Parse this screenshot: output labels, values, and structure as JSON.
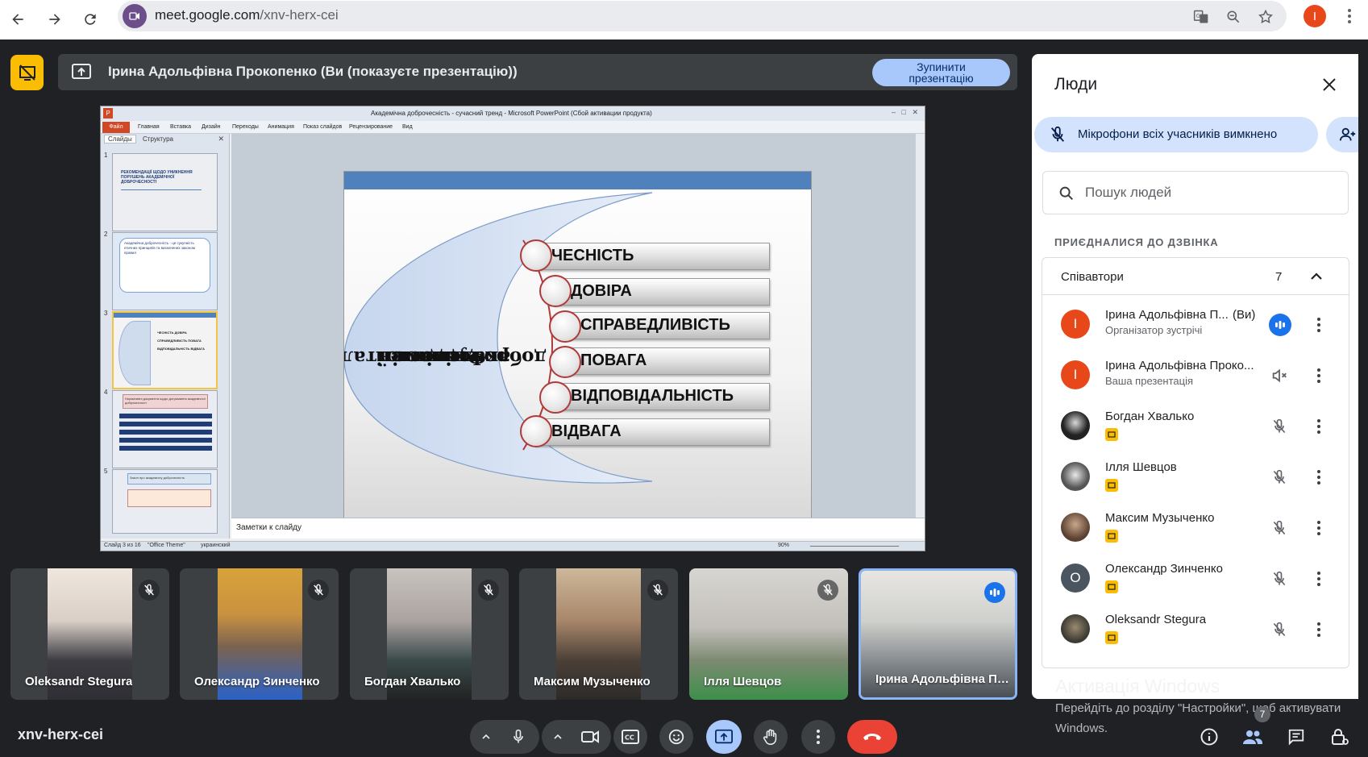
{
  "browser": {
    "url_host": "meet.google.com",
    "url_path": "/xnv-herx-cei",
    "profile_initial": "I"
  },
  "presentation_bar": {
    "title": "Ірина Адольфівна Прокопенко (Ви (показуєте презентацію))",
    "stop_label_line1": "Зупинити",
    "stop_label_line2": "презентацію"
  },
  "powerpoint": {
    "window_title": "Академічна доброчесність - сучасний тренд - Microsoft PowerPoint (Сбой активации продукта)",
    "file_tab": "Файл",
    "tabs": [
      "Главная",
      "Вставка",
      "Дизайн",
      "Переходы",
      "Анимация",
      "Показ слайдов",
      "Рецензирование",
      "Вид"
    ],
    "panel_tabs": [
      "Слайды",
      "Структура"
    ],
    "thumbnails": [
      {
        "num": "1",
        "text": "РЕКОМЕНДАЦІЇ ЩОДО УНИКНЕННЯ ПОРУШЕНЬ АКАДЕМІЧНОЇ ДОБРОЧЕСНОСТІ"
      },
      {
        "num": "2",
        "text": "Академічна доброчесність - це сукупність етичних принципів та визначених законом правил"
      },
      {
        "num": "3",
        "text": "ЧЕСНІСТЬ ДОВІРА СПРАВЕДЛИВІСТЬ ПОВАГА ВІДПОВІДАЛЬНІСТЬ ВІДВАГА"
      },
      {
        "num": "4",
        "text": "Нормативні документи щодо дотримання академічної доброчесності"
      },
      {
        "num": "5",
        "text": "Закон про академічну доброчесність"
      }
    ],
    "notes_placeholder": "Заметки к слайду",
    "status_slide": "Слайд 3 из 16",
    "status_theme": "\"Office Theme\"",
    "status_lang": "украинский",
    "zoom": "90%"
  },
  "slide": {
    "vertical_title_line1": "Фундаментальні",
    "vertical_title_line2": "цінності",
    "vertical_title_line3": "академічної",
    "vertical_title_line4": "доброчесності",
    "values": [
      "ЧЕСНІСТЬ",
      "ДОВІРА",
      "СПРАВЕДЛИВІСТЬ",
      "ПОВАГА",
      "ВІДПОВІДАЛЬНІСТЬ",
      "ВІДВАГА"
    ]
  },
  "tiles": [
    {
      "name": "Oleksandr Stegura",
      "mic": "muted"
    },
    {
      "name": "Олександр Зинченко",
      "mic": "muted"
    },
    {
      "name": "Богдан Хвалько",
      "mic": "muted"
    },
    {
      "name": "Максим Музыченко",
      "mic": "muted"
    },
    {
      "name": "Ілля Шевцов",
      "mic": "muted"
    },
    {
      "name": "Ірина Адольфівна Прокопенко",
      "mic": "speaking"
    }
  ],
  "people_panel": {
    "title": "Люди",
    "mute_all": "Мікрофони всіх учасників вимкнено",
    "search_placeholder": "Пошук людей",
    "joined_label": "ПРИЄДНАЛИСЯ ДО ДЗВІНКА",
    "cohosts_label": "Співавтори",
    "cohosts_count": "7",
    "people": [
      {
        "name": "Ірина Адольфівна П...",
        "you": "(Ви)",
        "sub": "Організатор зустрічі",
        "initial": "І",
        "avatar_color": "#e8471a"
      },
      {
        "name": "Ірина Адольфівна Проко...",
        "sub": "Ваша презентація",
        "initial": "І",
        "avatar_color": "#e8471a"
      },
      {
        "name": "Богдан Хвалько"
      },
      {
        "name": "Ілля Шевцов"
      },
      {
        "name": "Максим Музыченко"
      },
      {
        "name": "Олександр Зинченко",
        "initial": "О",
        "avatar_color": "#4a5560"
      },
      {
        "name": "Oleksandr Stegura"
      }
    ]
  },
  "windows_activation": {
    "title": "Активація Windows",
    "line1": "Перейдіть до розділу \"Настройки\", щоб активувати",
    "line2": "Windows."
  },
  "bottom_bar": {
    "meeting_code": "xnv-herx-cei",
    "participants_count": "7"
  },
  "colors": {
    "meet_bg": "#202124",
    "accent_blue": "#a8c7fa",
    "present_yellow": "#fbbc04",
    "hangup_red": "#ea4335"
  }
}
